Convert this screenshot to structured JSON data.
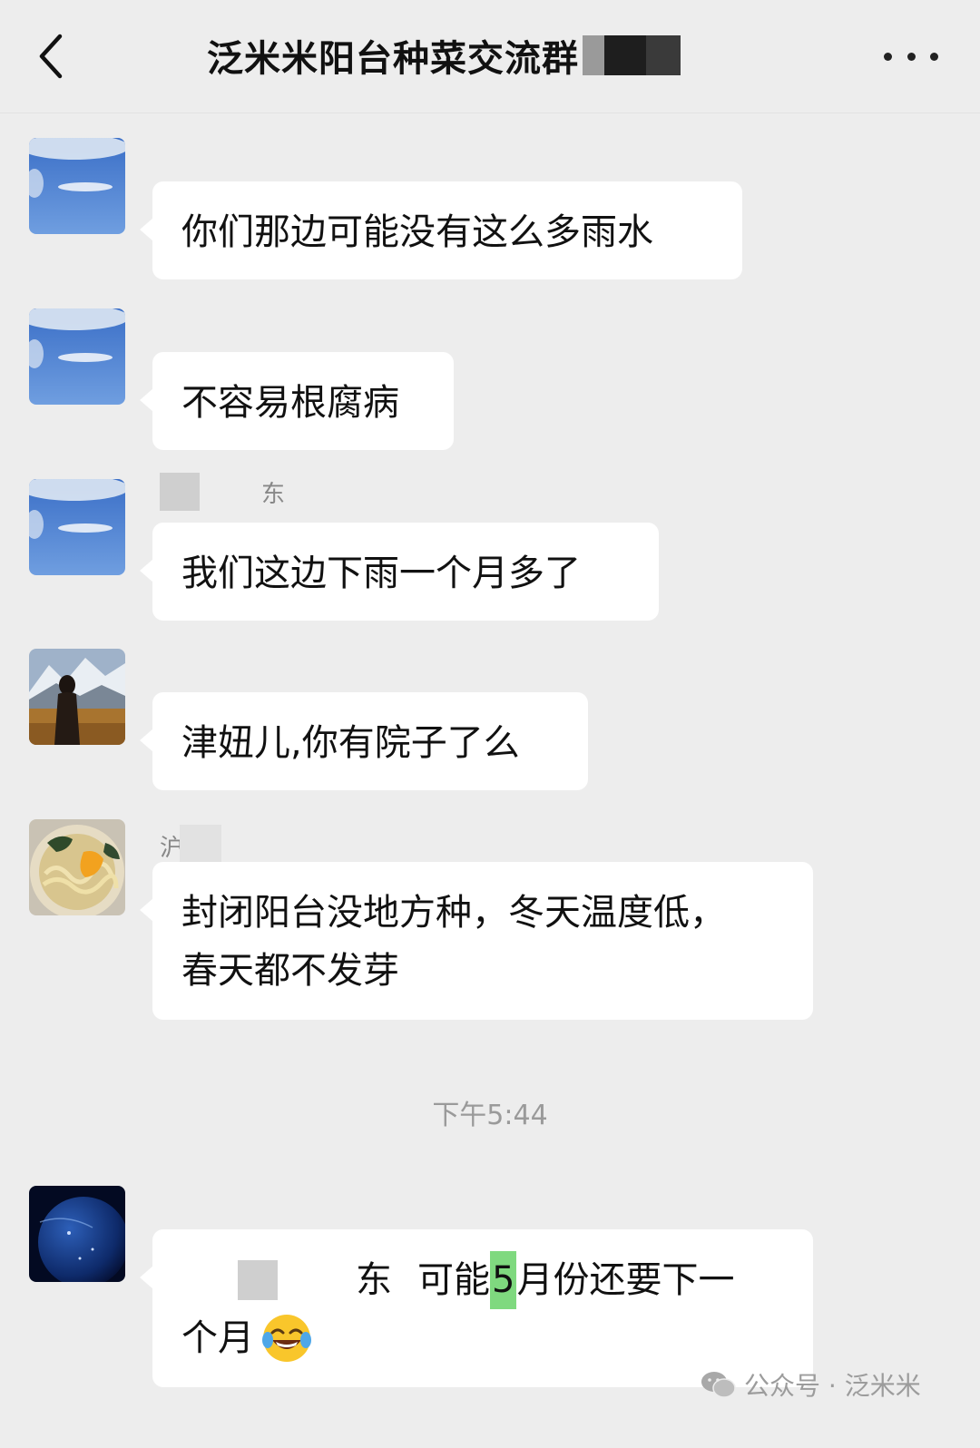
{
  "header": {
    "title": "泛米米阳台种菜交流群"
  },
  "messages": [
    {
      "text": "你们那边可能没有这么多雨水"
    },
    {
      "text": "不容易根腐病"
    },
    {
      "nick": "东",
      "text": "我们这边下雨一个月多了"
    },
    {
      "text": "津妞儿,你有院子了么"
    },
    {
      "nick": "沪",
      "line1": "封闭阳台没地方种，冬天温度低，",
      "line2": "春天都不发芽"
    }
  ],
  "timestamp": "下午5:44",
  "last_message": {
    "mention": "东",
    "part1": "可能",
    "highlight": "5",
    "part2": "月份还要下一",
    "line2": "个月"
  },
  "watermark": {
    "label": "公众号 · 泛米米"
  },
  "colors": {
    "background": "#ededed",
    "bubble": "#ffffff",
    "highlight": "#7fd97f",
    "timestamp": "#9a9a9a"
  },
  "icons": {
    "back": "chevron-left-icon",
    "more": "more-dots-icon",
    "emoji": "tears-of-joy-emoji",
    "watermark": "wechat-icon"
  }
}
